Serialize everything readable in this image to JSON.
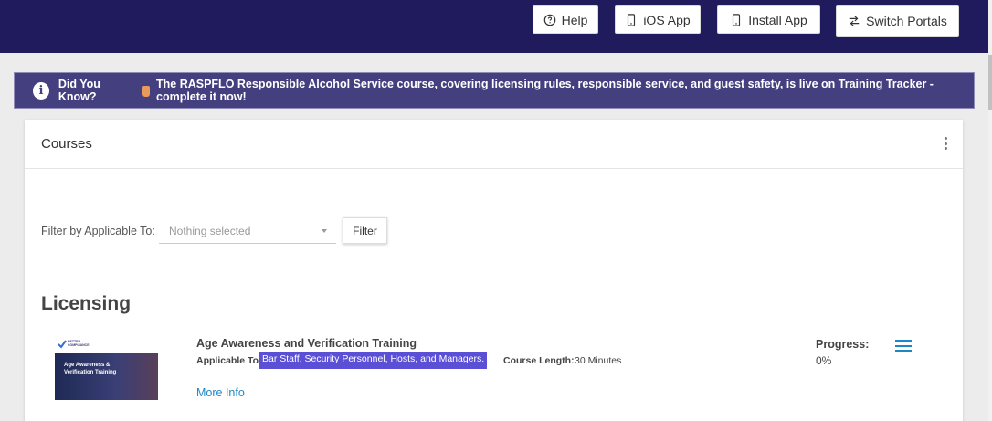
{
  "topbar": {
    "help_label": "Help",
    "ios_label": "iOS App",
    "install_label": "Install App",
    "switch_label": "Switch Portals",
    "background": "#1f1b5c"
  },
  "banner": {
    "lead": "Did You Know?",
    "message": "The RASPFLO Responsible Alcohol Service course, covering licensing rules, responsible service, and guest safety, is live on Training Tracker - complete it now!",
    "background": "#443f7f"
  },
  "card": {
    "title": "Courses",
    "filter_label": "Filter by Applicable To:",
    "filter_placeholder": "Nothing selected",
    "filter_button": "Filter"
  },
  "sections": [
    {
      "title": "Licensing",
      "courses": [
        {
          "title": "Age Awareness and Verification Training",
          "thumbnail": {
            "logo_text_1": "BETTER",
            "logo_text_2": "COMPLIANCE",
            "caption_1": "Age Awareness &",
            "caption_2": "Verification Training"
          },
          "applicable_label": "Applicable To:",
          "applicable_value": "Bar Staff, Security Personnel, Hosts, and Managers.",
          "length_label": "Course Length:",
          "length_value": "30 Minutes",
          "more_info": "More Info",
          "progress_label": "Progress:",
          "progress_value": "0%"
        }
      ]
    }
  ]
}
